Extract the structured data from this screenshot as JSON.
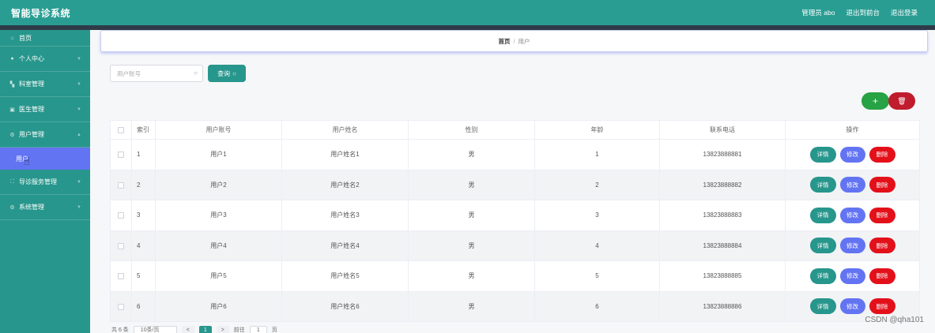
{
  "header": {
    "title": "智能导诊系统",
    "user_label": "管理员 abo",
    "front_link": "退出到前台",
    "logout": "退出登录"
  },
  "sidebar": {
    "items": [
      {
        "label": "首页",
        "icon": "home-icon"
      },
      {
        "label": "个人中心",
        "icon": "user-icon"
      },
      {
        "label": "科室管理",
        "icon": "flag-icon"
      },
      {
        "label": "医生管理",
        "icon": "doctor-icon"
      },
      {
        "label": "用户管理",
        "icon": "settings-icon"
      },
      {
        "label": "导诊服务管理",
        "icon": "service-icon"
      },
      {
        "label": "系统管理",
        "icon": "system-icon"
      }
    ],
    "active_sub": "用户"
  },
  "breadcrumb": {
    "home": "首页",
    "separator": "/",
    "current": "用户"
  },
  "search": {
    "placeholder": "用户账号",
    "button": "查询"
  },
  "table": {
    "columns": [
      "索引",
      "用户账号",
      "用户姓名",
      "性别",
      "年龄",
      "联系电话",
      "操作"
    ],
    "rows": [
      {
        "index": "1",
        "account": "用户1",
        "name": "用户姓名1",
        "gender": "男",
        "age": "1",
        "phone": "13823888881"
      },
      {
        "index": "2",
        "account": "用户2",
        "name": "用户姓名2",
        "gender": "男",
        "age": "2",
        "phone": "13823888882"
      },
      {
        "index": "3",
        "account": "用户3",
        "name": "用户姓名3",
        "gender": "男",
        "age": "3",
        "phone": "13823888883"
      },
      {
        "index": "4",
        "account": "用户4",
        "name": "用户姓名4",
        "gender": "男",
        "age": "4",
        "phone": "13823888884"
      },
      {
        "index": "5",
        "account": "用户5",
        "name": "用户姓名5",
        "gender": "男",
        "age": "5",
        "phone": "13823888885"
      },
      {
        "index": "6",
        "account": "用户6",
        "name": "用户姓名6",
        "gender": "男",
        "age": "6",
        "phone": "13823888886"
      }
    ],
    "actions": {
      "detail": "详情",
      "edit": "修改",
      "delete": "删除"
    }
  },
  "pagination": {
    "total": "共 6 条",
    "page_size": "10条/页",
    "prev": "<",
    "current": "1",
    "next": ">",
    "goto": "前往",
    "goto_value": "1",
    "page_unit": "页"
  },
  "watermark": "CSDN @qha101",
  "colors": {
    "primary": "#27968c",
    "accent": "#6374f2",
    "danger": "#e3101a",
    "add": "#27a244"
  }
}
